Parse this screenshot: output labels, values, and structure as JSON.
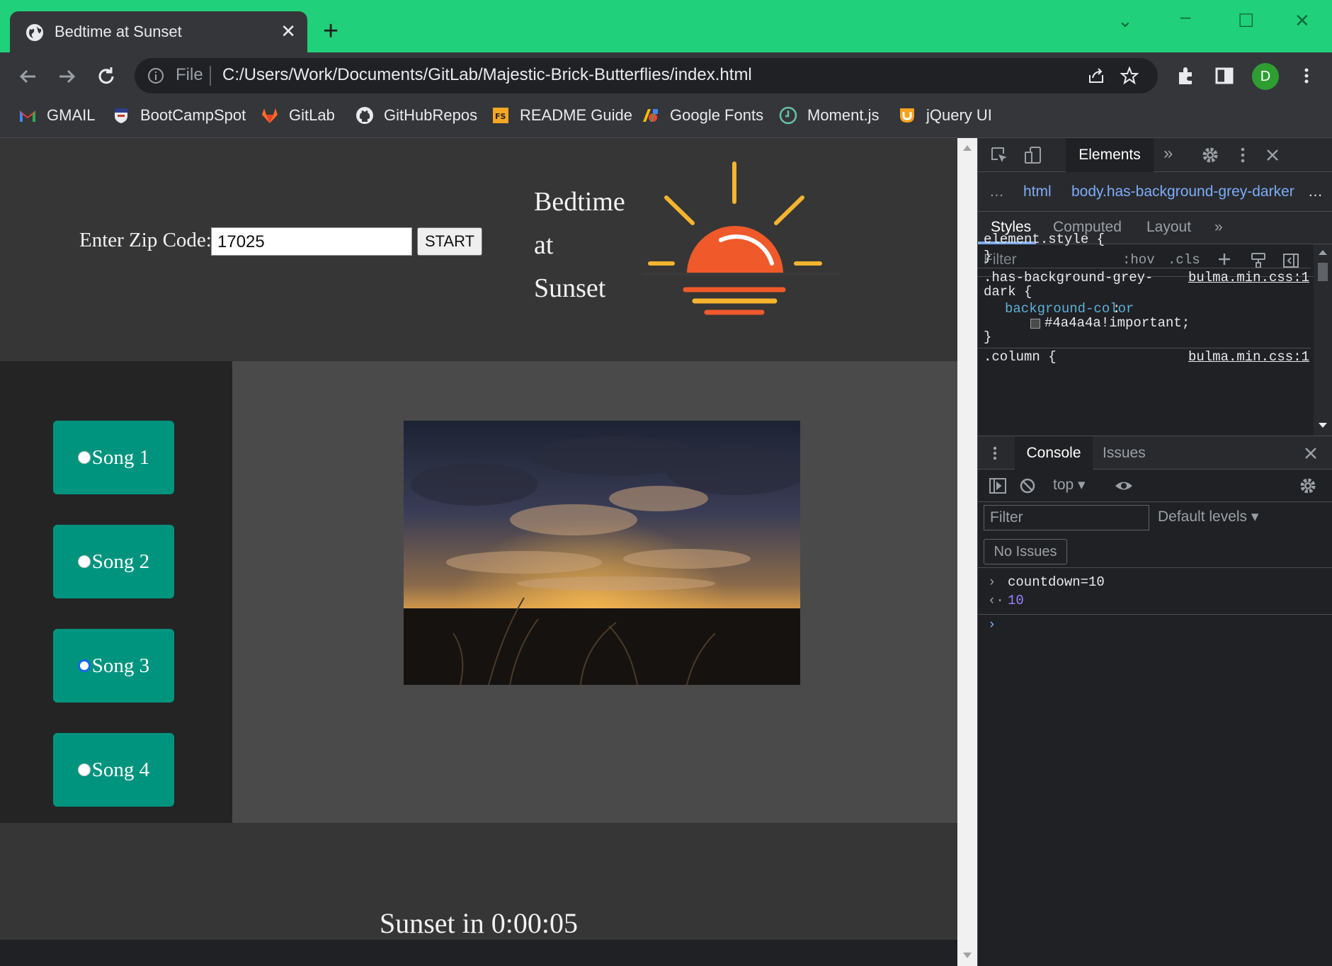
{
  "browser": {
    "tab_title": "Bedtime at Sunset",
    "tab_close": "✕",
    "new_tab": "+",
    "url_scheme": "File",
    "url": "C:/Users/Work/Documents/GitLab/Majestic-Brick-Butterflies/index.html",
    "profile_initial": "D",
    "bookmarks": [
      {
        "label": "GMAIL",
        "icon": "gmail-icon"
      },
      {
        "label": "BootCampSpot",
        "icon": "penn-shield-icon"
      },
      {
        "label": "GitLab",
        "icon": "gitlab-icon"
      },
      {
        "label": "GitHubRepos",
        "icon": "github-icon"
      },
      {
        "label": "README Guide",
        "icon": "fs-icon"
      },
      {
        "label": "Google Fonts",
        "icon": "google-fonts-icon"
      },
      {
        "label": "Moment.js",
        "icon": "clock-icon"
      },
      {
        "label": "jQuery UI",
        "icon": "jquery-ui-icon"
      }
    ],
    "titlebar_color": "#21d07a"
  },
  "page": {
    "zip_label": "Enter Zip Code:",
    "zip_value": "17025",
    "start_label": "START",
    "title_line1": "Bedtime",
    "title_line2": "at",
    "title_line3": "Sunset",
    "songs": [
      {
        "label": "Song 1",
        "selected": false
      },
      {
        "label": "Song 2",
        "selected": false
      },
      {
        "label": "Song 3",
        "selected": true
      },
      {
        "label": "Song 4",
        "selected": false
      }
    ],
    "countdown": "Sunset in 0:00:05",
    "song_button_color": "#00947e"
  },
  "devtools": {
    "main_tab": "Elements",
    "more_tabs": "»",
    "breadcrumbs": {
      "ellipsis": "…",
      "html": "html",
      "body": "body.has-background-grey-darker",
      "more": "…"
    },
    "subtabs": [
      "Styles",
      "Computed",
      "Layout",
      "»"
    ],
    "styles_filter_placeholder": "Filter",
    "hov": ":hov",
    "cls": ".cls",
    "rules": {
      "element_style": "element.style {",
      "element_style_close": "}",
      "rule1_selector_line1": ".has-background-grey-",
      "rule1_selector_line2": "dark {",
      "rule1_prop": "background-color",
      "rule1_value": "#4a4a4a!important;",
      "rule1_close": "}",
      "rule1_source": "bulma.min.css:1",
      "rule2_selector": ".column {",
      "rule2_source": "bulma.min.css:1"
    },
    "console_tab": "Console",
    "issues_tab": "Issues",
    "context": "top",
    "console_filter_placeholder": "Filter",
    "levels": "Default levels",
    "no_issues": "No Issues",
    "console_input": "countdown=10",
    "console_output": "10"
  }
}
